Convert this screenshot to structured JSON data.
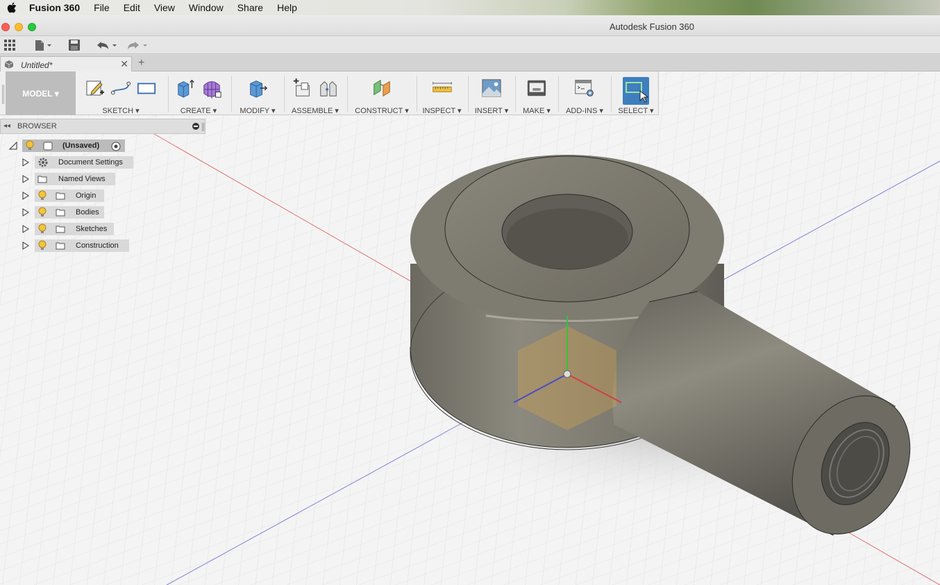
{
  "menubar": {
    "app_name": "Fusion 360",
    "items": [
      "File",
      "Edit",
      "View",
      "Window",
      "Share",
      "Help"
    ]
  },
  "window": {
    "title": "Autodesk Fusion 360"
  },
  "tabs": {
    "document_tab": "Untitled*"
  },
  "toolbar": {
    "workspace": "MODEL ▾",
    "groups": [
      {
        "label": "SKETCH ▾"
      },
      {
        "label": "CREATE ▾"
      },
      {
        "label": "MODIFY ▾"
      },
      {
        "label": "ASSEMBLE ▾"
      },
      {
        "label": "CONSTRUCT ▾"
      },
      {
        "label": "INSPECT ▾"
      },
      {
        "label": "INSERT ▾"
      },
      {
        "label": "MAKE ▾"
      },
      {
        "label": "ADD-INS ▾"
      },
      {
        "label": "SELECT ▾"
      }
    ]
  },
  "browser": {
    "title": "BROWSER",
    "root": "(Unsaved)",
    "items": [
      {
        "label": "Document Settings",
        "icon": "gear-icon"
      },
      {
        "label": "Named Views",
        "icon": "folder-icon"
      },
      {
        "label": "Origin",
        "icon": "folder-icon"
      },
      {
        "label": "Bodies",
        "icon": "folder-icon"
      },
      {
        "label": "Sketches",
        "icon": "folder-icon"
      },
      {
        "label": "Construction",
        "icon": "folder-icon"
      }
    ]
  },
  "colors": {
    "accent": "#3d7fbf",
    "model": "#7a776e",
    "x_axis": "#e05050",
    "z_axis": "#5a5ad0"
  }
}
